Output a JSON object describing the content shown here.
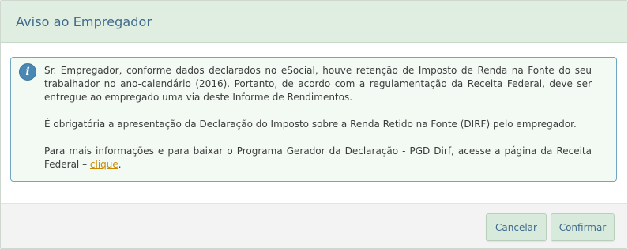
{
  "modal": {
    "title": "Aviso ao Empregador"
  },
  "alert": {
    "icon": "info-icon",
    "paragraph1": "Sr. Empregador, conforme dados declarados no eSocial, houve retenção de Imposto de Renda na Fonte do seu trabalhador no ano-calendário (2016). Portanto, de acordo com a regulamentação da Receita Federal, deve ser entregue ao empregado uma via deste Informe de Rendimentos.",
    "paragraph2": "É obrigatória a apresentação da Declaração do Imposto sobre a Renda Retido na Fonte (DIRF) pelo empregador.",
    "paragraph3_prefix": "Para mais informações e para baixar o Programa Gerador da Declaração - PGD Dirf, acesse a página da Receita Federal – ",
    "link_label": "clique",
    "paragraph3_suffix": "."
  },
  "footer": {
    "cancel_label": "Cancelar",
    "confirm_label": "Confirmar"
  },
  "colors": {
    "header_bg": "#dfeee1",
    "title": "#3f6a8c",
    "alert_border": "#6fa7c2",
    "alert_bg": "#f3faf4",
    "link": "#c98a00",
    "button_bg": "#d8eadb"
  }
}
